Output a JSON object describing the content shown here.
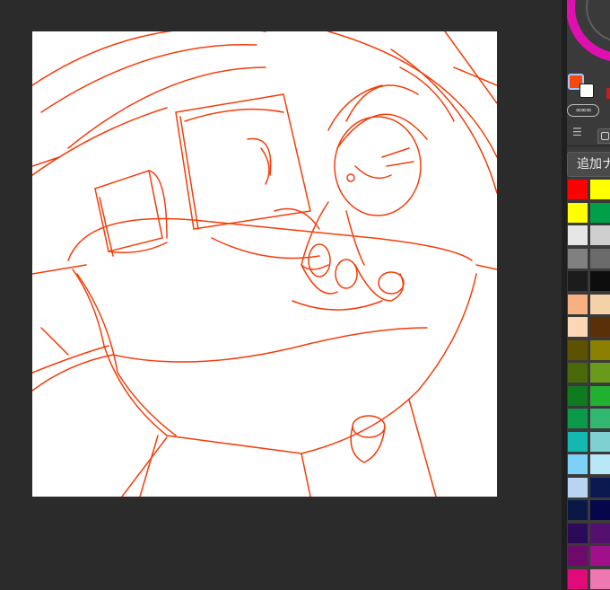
{
  "canvas": {
    "background": "#ffffff",
    "stroke_color": "#f53c0a"
  },
  "color_panel": {
    "main_color": "#f5480a",
    "sub_color": "#ffffff",
    "chain_label": "∞∞∞",
    "add_button_label": "追加ナ",
    "palette": [
      "#ff0000",
      "#ffff00",
      "#ffff00",
      "#00a04a",
      "#e6e6e6",
      "#cfcfcf",
      "#808080",
      "#6b6b6b",
      "#1c1c1c",
      "#0d0d0d",
      "#f7b081",
      "#f5d1a8",
      "#fbd7b6",
      "#5a3008",
      "#5c5200",
      "#8b8000",
      "#4a6a0a",
      "#6a9a1a",
      "#0f7a1e",
      "#22b030",
      "#0a9a4a",
      "#33b870",
      "#14b8b0",
      "#7fd0d0",
      "#7dd0f8",
      "#b8e8f8",
      "#b8d4f0",
      "#0a1a50",
      "#0a1848",
      "#06064a",
      "#2c0a5a",
      "#54106e",
      "#6e0a6a",
      "#a0108a",
      "#e00a78",
      "#f078b0"
    ]
  }
}
